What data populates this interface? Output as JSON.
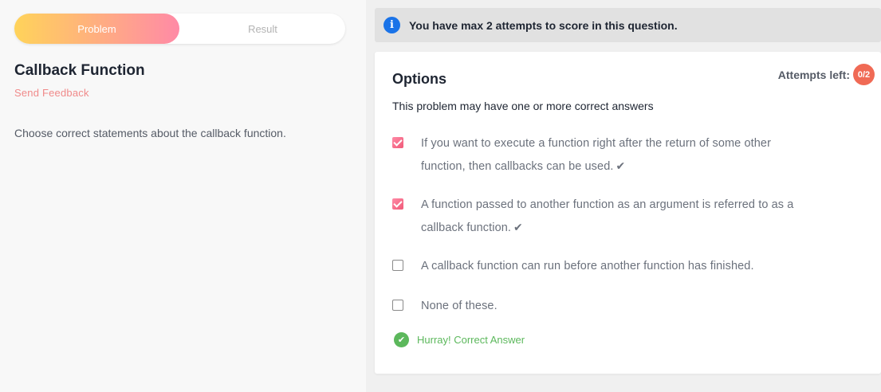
{
  "tabs": [
    {
      "label": "Problem",
      "active": true
    },
    {
      "label": "Result",
      "active": false
    }
  ],
  "problem": {
    "title": "Callback Function",
    "feedback_link": "Send Feedback",
    "description": "Choose correct statements about the callback function."
  },
  "info": {
    "icon": "info-icon",
    "text": "You have max 2 attempts to score in this question."
  },
  "options_panel": {
    "title": "Options",
    "attempts_label": "Attempts left:",
    "attempts_value": "0/2",
    "hint": "This problem may have one or more correct answers",
    "options": [
      {
        "line1": "If you want to execute a function right after the return of some other",
        "line2": "function, then callbacks can be used.",
        "checked": true,
        "correct_mark": "✔"
      },
      {
        "line1": "A function passed to another function as an argument is referred to as a",
        "line2": "callback function.",
        "checked": true,
        "correct_mark": "✔"
      },
      {
        "line1": "A callback function can run before another function has finished.",
        "line2": "",
        "checked": false,
        "correct_mark": ""
      },
      {
        "line1": "None of these.",
        "line2": "",
        "checked": false,
        "correct_mark": ""
      }
    ],
    "result_text": "Hurray! Correct Answer"
  },
  "colors": {
    "accent_gradient_start": "#ffd35a",
    "accent_gradient_end": "#ff8aa6",
    "info_blue": "#1a73e8",
    "badge_red": "#f06a55",
    "success_green": "#5cb85c"
  }
}
